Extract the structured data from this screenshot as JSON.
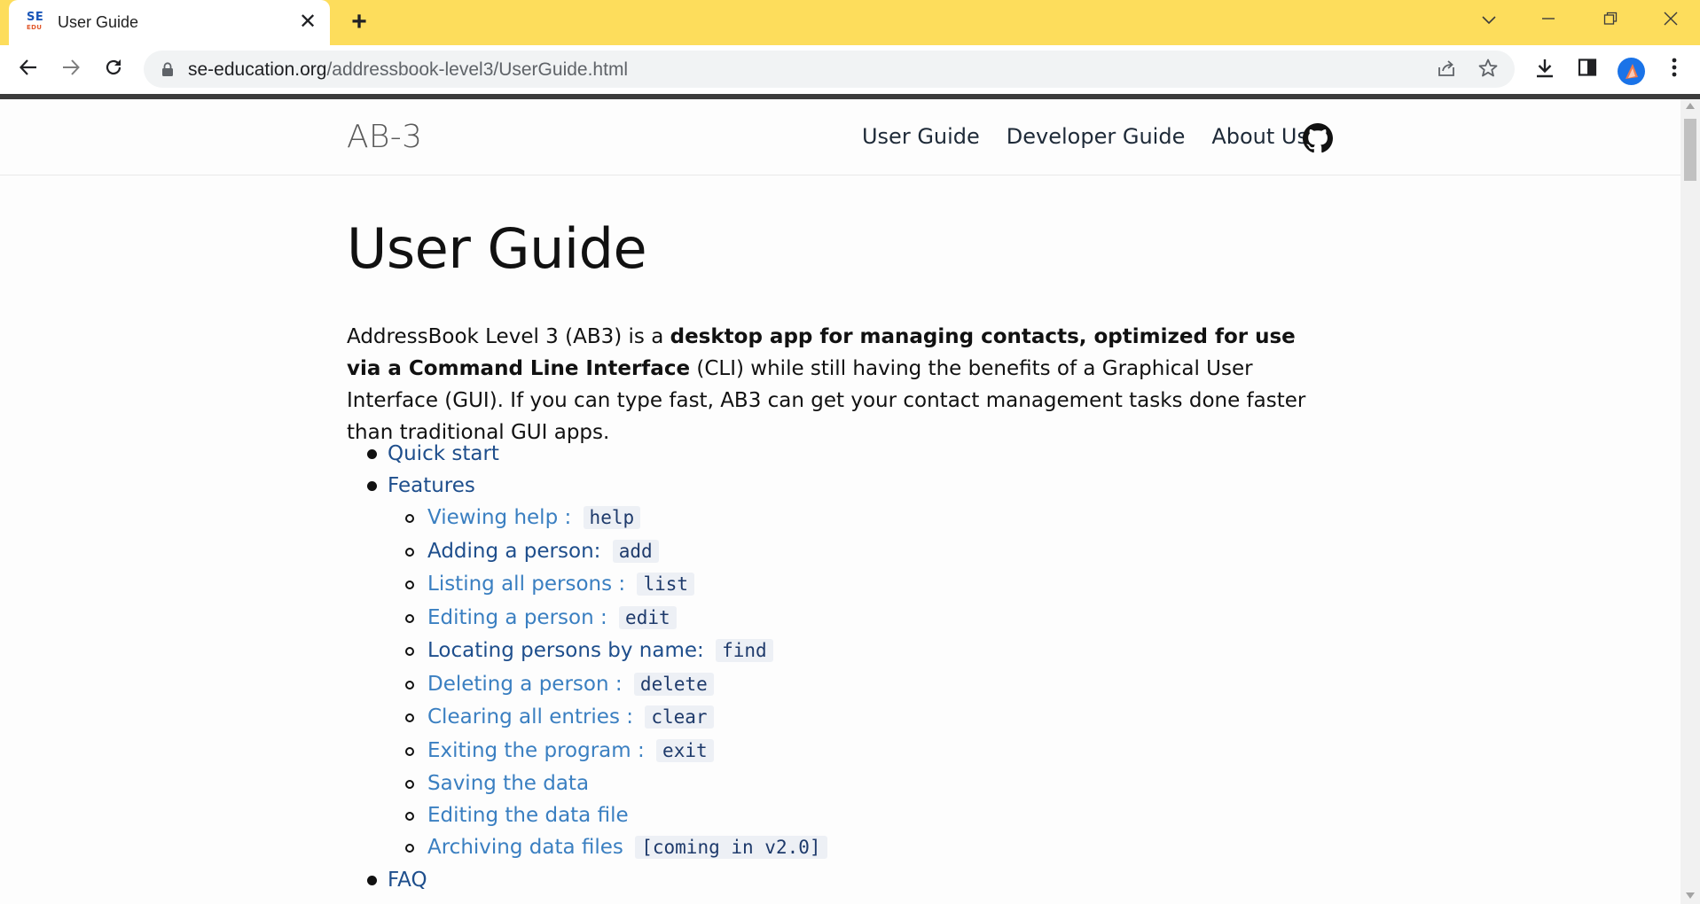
{
  "browser": {
    "tab_title": "User Guide",
    "favicon_top": "SE",
    "favicon_bottom": "EDU",
    "url_domain": "se-education.org",
    "url_path": "/addressbook-level3/UserGuide.html"
  },
  "site": {
    "title": "AB-3",
    "nav": [
      "User Guide",
      "Developer Guide",
      "About Us"
    ]
  },
  "page": {
    "heading": "User Guide",
    "intro_1": "AddressBook Level 3 (AB3) is a ",
    "intro_bold_1": "desktop app for managing contacts, optimized for use via a Command Line Interface",
    "intro_2": " (CLI) while still having the benefits of a Graphical User Interface (GUI). If you can type fast, AB3 can get your contact management tasks done faster than traditional GUI apps."
  },
  "toc": {
    "top": [
      {
        "label": "Quick start"
      },
      {
        "label": "Features"
      },
      {
        "label": "FAQ"
      }
    ],
    "features": [
      {
        "label": "Viewing help : ",
        "code": "help"
      },
      {
        "label": "Adding a person: ",
        "code": "add"
      },
      {
        "label": "Listing all persons : ",
        "code": "list"
      },
      {
        "label": "Editing a person : ",
        "code": "edit"
      },
      {
        "label": "Locating persons by name: ",
        "code": "find"
      },
      {
        "label": "Deleting a person : ",
        "code": "delete"
      },
      {
        "label": "Clearing all entries : ",
        "code": "clear"
      },
      {
        "label": "Exiting the program : ",
        "code": "exit"
      },
      {
        "label": "Saving the data",
        "code": ""
      },
      {
        "label": "Editing the data file",
        "code": ""
      },
      {
        "label": "Archiving data files ",
        "code": "[coming in v2.0]"
      }
    ]
  },
  "colors": {
    "tabstrip": "#fddd5c",
    "link": "#3a7fc1",
    "visited_link": "#1e4e8c"
  }
}
